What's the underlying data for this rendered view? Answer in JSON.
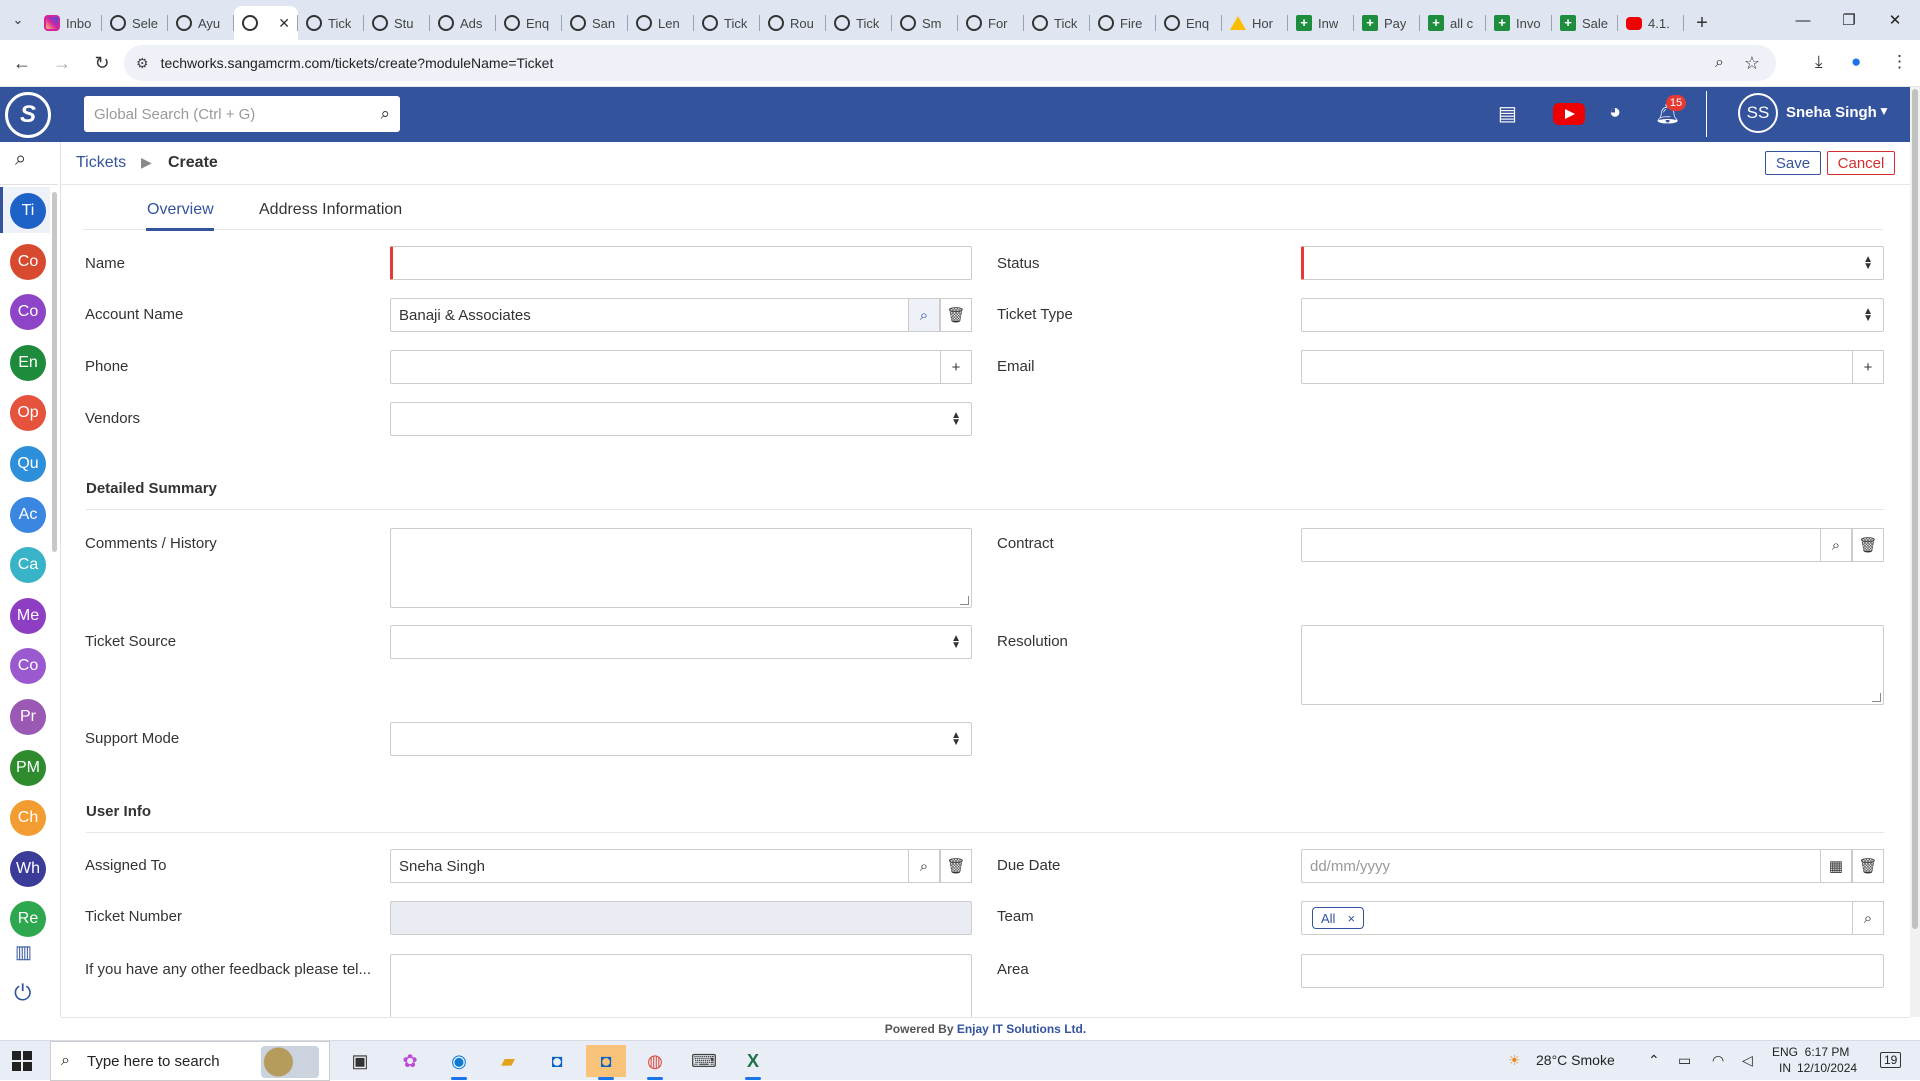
{
  "browser": {
    "tabs": [
      {
        "label": "Inbo",
        "icon": "instagram-icon"
      },
      {
        "label": "Sele",
        "icon": "crm-icon"
      },
      {
        "label": "Ayu",
        "icon": "crm-icon"
      },
      {
        "label": "",
        "icon": "crm-icon",
        "active": true
      },
      {
        "label": "Tick",
        "icon": "crm-icon"
      },
      {
        "label": "Stu",
        "icon": "crm-icon"
      },
      {
        "label": "Ads",
        "icon": "crm-icon"
      },
      {
        "label": "Enq",
        "icon": "crm-icon"
      },
      {
        "label": "San",
        "icon": "crm-icon"
      },
      {
        "label": "Len",
        "icon": "crm-icon"
      },
      {
        "label": "Tick",
        "icon": "crm-icon"
      },
      {
        "label": "Rou",
        "icon": "crm-icon"
      },
      {
        "label": "Tick",
        "icon": "crm-icon"
      },
      {
        "label": "Sm",
        "icon": "crm-icon"
      },
      {
        "label": "For",
        "icon": "crm-icon"
      },
      {
        "label": "Tick",
        "icon": "crm-icon"
      },
      {
        "label": "Fire",
        "icon": "crm-icon"
      },
      {
        "label": "Enq",
        "icon": "crm-icon"
      },
      {
        "label": "Hor",
        "icon": "drive-icon"
      },
      {
        "label": "Inw",
        "icon": "sheets-icon"
      },
      {
        "label": "Pay",
        "icon": "sheets-icon"
      },
      {
        "label": "all c",
        "icon": "sheets-icon"
      },
      {
        "label": "Invo",
        "icon": "sheets-icon"
      },
      {
        "label": "Sale",
        "icon": "sheets-icon"
      },
      {
        "label": "4.1.",
        "icon": "youtube-icon"
      }
    ],
    "url": "techworks.sangamcrm.com/tickets/create?moduleName=Ticket"
  },
  "header": {
    "search_placeholder": "Global Search (Ctrl + G)",
    "notification_count": "15",
    "user_initials": "SS",
    "user_name": "Sneha Singh"
  },
  "sidebar": {
    "items": [
      {
        "abbr": "Ti",
        "color": "#1e62c8"
      },
      {
        "abbr": "Co",
        "color": "#d84a2f"
      },
      {
        "abbr": "Co",
        "color": "#8e44c6"
      },
      {
        "abbr": "En",
        "color": "#1e8a3c"
      },
      {
        "abbr": "Op",
        "color": "#e5533d"
      },
      {
        "abbr": "Qu",
        "color": "#2d8fd9"
      },
      {
        "abbr": "Ac",
        "color": "#3a86e0"
      },
      {
        "abbr": "Ca",
        "color": "#39b3c7"
      },
      {
        "abbr": "Me",
        "color": "#8e3ec2"
      },
      {
        "abbr": "Co",
        "color": "#9b59d0"
      },
      {
        "abbr": "Pr",
        "color": "#9b59b6"
      },
      {
        "abbr": "PM",
        "color": "#2e8b2e"
      },
      {
        "abbr": "Ch",
        "color": "#f39c32"
      },
      {
        "abbr": "Wh",
        "color": "#3b3b9a"
      },
      {
        "abbr": "Re",
        "color": "#2ea84e"
      }
    ]
  },
  "breadcrumb": {
    "module": "Tickets",
    "action": "Create"
  },
  "actions": {
    "save": "Save",
    "cancel": "Cancel"
  },
  "form": {
    "tabs": [
      "Overview",
      "Address Information"
    ],
    "labels": {
      "name": "Name",
      "status": "Status",
      "account_name": "Account Name",
      "ticket_type": "Ticket Type",
      "phone": "Phone",
      "email": "Email",
      "vendors": "Vendors",
      "comments": "Comments / History",
      "contract": "Contract",
      "ticket_source": "Ticket Source",
      "resolution": "Resolution",
      "support_mode": "Support Mode",
      "assigned_to": "Assigned To",
      "due_date": "Due Date",
      "ticket_number": "Ticket Number",
      "team": "Team",
      "feedback": "If you have any other feedback please tel...",
      "area": "Area"
    },
    "sections": {
      "detailed_summary": "Detailed Summary",
      "user_info": "User Info"
    },
    "values": {
      "account_name": "Banaji & Associates",
      "assigned_to": "Sneha Singh",
      "due_date_placeholder": "dd/mm/yyyy",
      "team_chip": "All",
      "team_chip_remove": "×"
    }
  },
  "footer": {
    "prefix": "Powered By",
    "company": "Enjay IT Solutions Ltd."
  },
  "taskbar": {
    "search_placeholder": "Type here to search",
    "weather": "28°C  Smoke",
    "lang_top": "ENG",
    "lang_bottom": "IN",
    "time": "6:17 PM",
    "date": "12/10/2024",
    "notif_count": "19"
  }
}
